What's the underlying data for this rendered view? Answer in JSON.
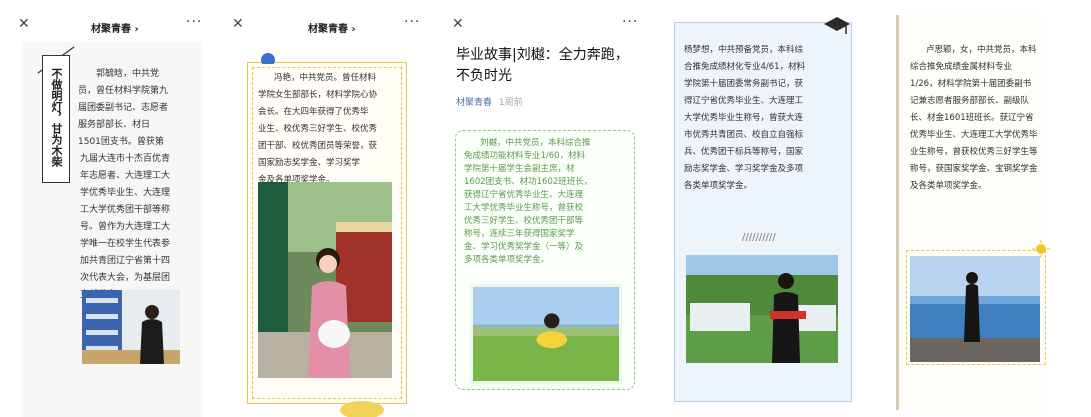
{
  "panels": [
    {
      "id": "p1",
      "header": "材聚青春 ›",
      "close": "✕",
      "more": "···",
      "banner_text": "不做明灯，甘为木柴",
      "lines": [
        "郭毓晗，中共党",
        "员，曾任材料学院第九",
        "届团委副书记、志愿者",
        "服务部部长、材日",
        "1501团支书。曾获第",
        "九届大连市十杰百优青",
        "年志愿者、大连理工大",
        "学优秀毕业生、大连理",
        "工大学优秀团干部等称",
        "号。曾作为大连理工大",
        "学唯一在校学生代表参",
        "加共青团辽宁省第十四",
        "次代表大会，为基层团",
        "支部发声。"
      ]
    },
    {
      "id": "p2",
      "header": "材聚青春 ›",
      "close": "✕",
      "more": "···",
      "lines": [
        "冯艳，中共党员。曾任材料",
        "学院女生部部长，材料学院心协",
        "会长。在大四年获得了优秀毕",
        "业生、校优秀三好学生、校优秀",
        "团干部、校优秀团员等荣誉，获",
        "国家励志奖学金、学习奖学",
        "金及各单项奖学金。"
      ]
    },
    {
      "id": "p3",
      "close": "✕",
      "more": "···",
      "title": "毕业故事|刘樾：全力奔跑，不负时光",
      "source": "材聚青春",
      "ago": "1周前",
      "lines": [
        "刘樾，中共党员，本科综合推",
        "免成绩功能材料专业1/60，材料",
        "学院第十届学生会副主席，材",
        "1602团支书、材功1602班班长，",
        "获得辽宁省优秀毕业生、大连理",
        "工大学优秀毕业生称号，曾获校",
        "优秀三好学生、校优秀团干部等",
        "称号，连续三年获得国家奖学",
        "金、学习优秀奖学金（一等）及",
        "多项各类单项奖学金。"
      ]
    },
    {
      "id": "p4",
      "divider": "//////////",
      "lines": [
        "杨梦想，中共预备党员，本科综",
        "合推免成绩材化专业4/61，材料",
        "学院第十届团委常务副书记，获",
        "得辽宁省优秀毕业生、大连理工",
        "大学优秀毕业生称号，曾获大连",
        "市优秀共青团员、校自立自强标",
        "兵、优秀团干标兵等称号，国家",
        "励志奖学金、学习奖学金及多项",
        "各类单项奖学金。"
      ]
    },
    {
      "id": "p5",
      "lines": [
        "卢思颖，女，中共党员，本科",
        "综合推免成绩金属材料专业",
        "1/26，材料学院第十届团委副书",
        "记兼志愿者服务部部长、副级队",
        "长、材金1601班班长。获辽宁省",
        "优秀毕业生、大连理工大学优秀毕",
        "业生称号，曾获校优秀三好学生等",
        "称号，获国家奖学金、宝钢奖学金",
        "及各类单项奖学金。"
      ]
    }
  ],
  "colors": {
    "gold": "#e6c84b",
    "green": "#8fcf7a",
    "blue": "#b8cde6",
    "tan": "#d8cbb3"
  }
}
